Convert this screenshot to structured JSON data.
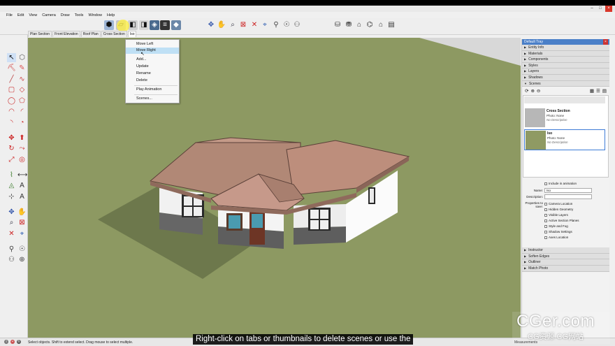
{
  "menu": [
    "File",
    "Edit",
    "View",
    "Camera",
    "Draw",
    "Tools",
    "Window",
    "Help"
  ],
  "scene_tabs": [
    "Plan Section",
    "Front Elevation",
    "Roof Plan",
    "Cross Section",
    "Iso"
  ],
  "context_menu": {
    "items": [
      "Move Left",
      "Move Right",
      "Add...",
      "Update",
      "Rename",
      "Delete",
      "Play Animation",
      "Scenes..."
    ],
    "hovered": "Move Right"
  },
  "tray": {
    "title": "Default Tray",
    "sections_top": [
      "Entity Info",
      "Materials",
      "Components",
      "Styles",
      "Layers",
      "Shadows",
      "Scenes"
    ],
    "scenes": [
      {
        "name": "Cross Section",
        "photo": "Photo: None",
        "desc": "No Description"
      },
      {
        "name": "Iso",
        "photo": "Photo: None",
        "desc": "No Description"
      }
    ],
    "include_in_animation": "Include in animation",
    "name_label": "Name:",
    "name_value": "Iso",
    "description_label": "Description:",
    "properties_label": "Properties to save:",
    "properties": [
      "Camera Location",
      "Hidden Geometry",
      "Visible Layers",
      "Active Section Planes",
      "Style and Fog",
      "Shadow Settings",
      "Axes Location"
    ],
    "sections_bottom": [
      "Instructor",
      "Soften Edges",
      "Outliner",
      "Match Photo"
    ]
  },
  "status": {
    "hint": "Select objects. Shift to extend select. Drag mouse to select multiple.",
    "measurements": "Measurements"
  },
  "caption": "Right-click on tabs or thumbnails to delete scenes or use the",
  "watermark": {
    "main": "CGer.com",
    "sub": "CG资源 CG网站"
  },
  "colors": {
    "accent": "#3d7bd6",
    "ground": "#8d9962",
    "roof": "#b88a7a",
    "wall": "#f4f4f4"
  }
}
